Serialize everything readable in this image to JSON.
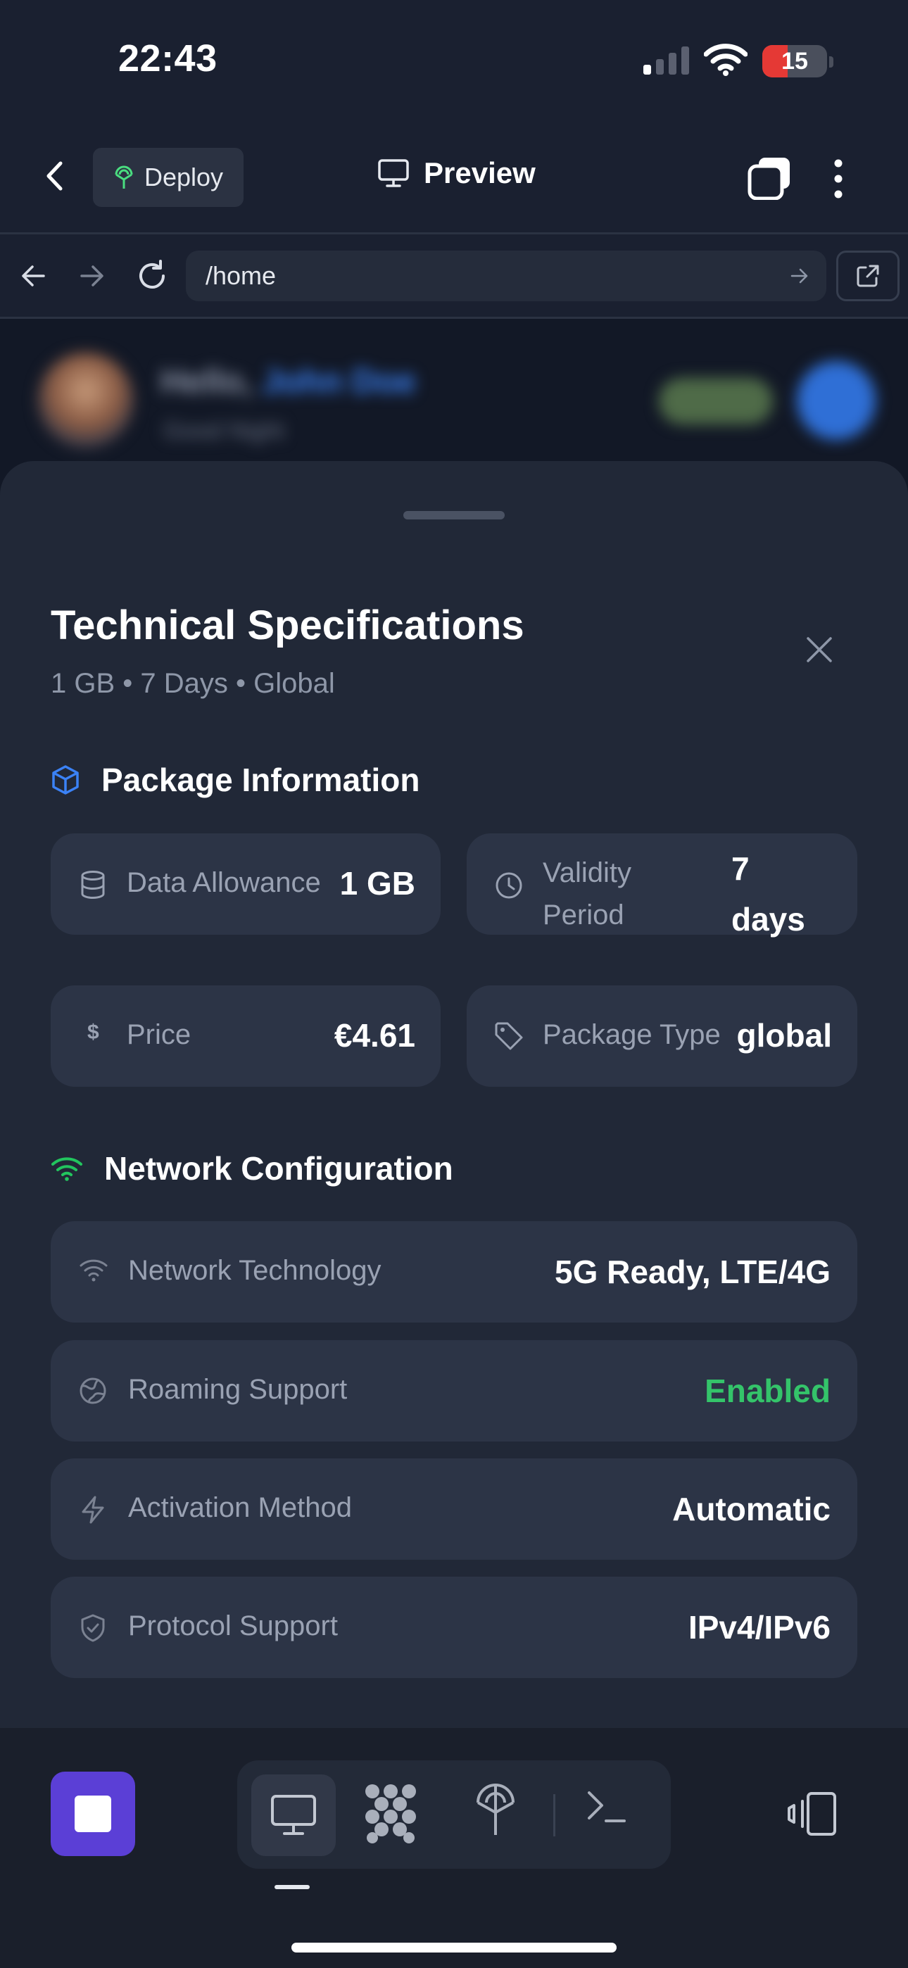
{
  "status_bar": {
    "time": "22:43",
    "battery": "15",
    "battery_level_percent": 15,
    "icons": [
      "signal-icon",
      "wifi-icon",
      "battery-charging-icon"
    ]
  },
  "header": {
    "deploy_label": "Deploy",
    "title": "Preview",
    "icons": [
      "back-icon",
      "deploy-antenna-icon",
      "monitor-icon",
      "tabs-icon",
      "more-vertical-icon"
    ]
  },
  "browser": {
    "url": "/home",
    "icons": [
      "arrow-left-icon",
      "arrow-right-icon",
      "reload-icon",
      "url-go-icon",
      "external-link-icon"
    ]
  },
  "background_page": {
    "greeting": "Hello,",
    "name": "John Doe",
    "subtitle": "Good Night"
  },
  "sheet": {
    "title": "Technical Specifications",
    "subtitle": "1 GB • 7 Days • Global",
    "package_section": {
      "title": "Package Information",
      "data_allowance": {
        "label": "Data Allowance",
        "value": "1 GB"
      },
      "validity": {
        "label_line1": "Validity",
        "label_line2": "Period",
        "value_line1": "7",
        "value_line2": "days"
      },
      "price": {
        "label": "Price",
        "value": "€4.61",
        "icon_symbol": "$"
      },
      "package_type": {
        "label": "Package Type",
        "value": "global"
      }
    },
    "network_section": {
      "title": "Network Configuration",
      "rows": [
        {
          "label": "Network Technology",
          "value": "5G Ready, LTE/4G",
          "icon": "wifi-icon"
        },
        {
          "label": "Roaming Support",
          "value": "Enabled",
          "icon": "globe-icon",
          "value_color": "#34c46a"
        },
        {
          "label": "Activation Method",
          "value": "Automatic",
          "icon": "lightning-icon"
        },
        {
          "label": "Protocol Support",
          "value": "IPv4/IPv6",
          "icon": "shield-check-icon"
        }
      ]
    }
  },
  "toolbar": {
    "icons": [
      "stop-icon",
      "monitor-icon",
      "apps-icon",
      "deploy-antenna-icon",
      "terminal-icon",
      "devices-icon"
    ],
    "active_tab": "preview"
  },
  "colors": {
    "background": "#1a2030",
    "sheet": "#212837",
    "card": "#2c3446",
    "accent_purple": "#5b3fd6",
    "accent_blue": "#3b82f6",
    "accent_green": "#34c46a",
    "battery_red": "#e53935"
  }
}
